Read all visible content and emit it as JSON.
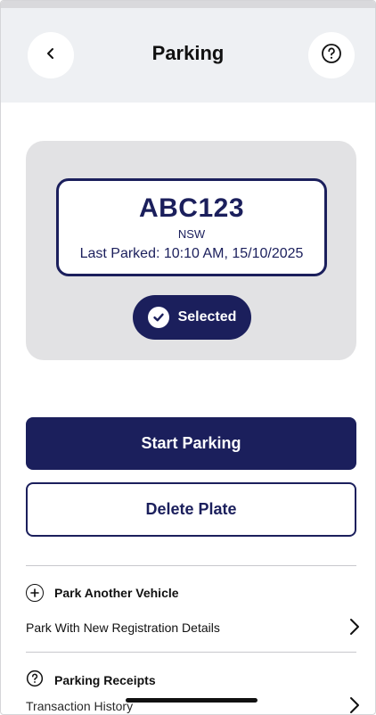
{
  "header": {
    "title": "Parking",
    "back_icon": "chevron-left-icon",
    "help_icon": "question-circle-icon"
  },
  "plate": {
    "number": "ABC123",
    "state": "NSW",
    "last_parked": "Last Parked: 10:10 AM, 15/10/2025",
    "selected_label": "Selected",
    "selected_icon": "check-circle-icon"
  },
  "actions": {
    "start_label": "Start Parking",
    "delete_label": "Delete Plate"
  },
  "sections": {
    "another_vehicle": {
      "title": "Park Another Vehicle",
      "icon": "plus-circle-icon",
      "link": "Park With New Registration Details"
    },
    "receipts": {
      "title": "Parking Receipts",
      "icon": "question-circle-icon",
      "link": "Transaction History"
    }
  },
  "colors": {
    "brand_navy": "#1b1f5c",
    "header_bg": "#eef0f3",
    "card_bg": "#e2e2e4"
  }
}
